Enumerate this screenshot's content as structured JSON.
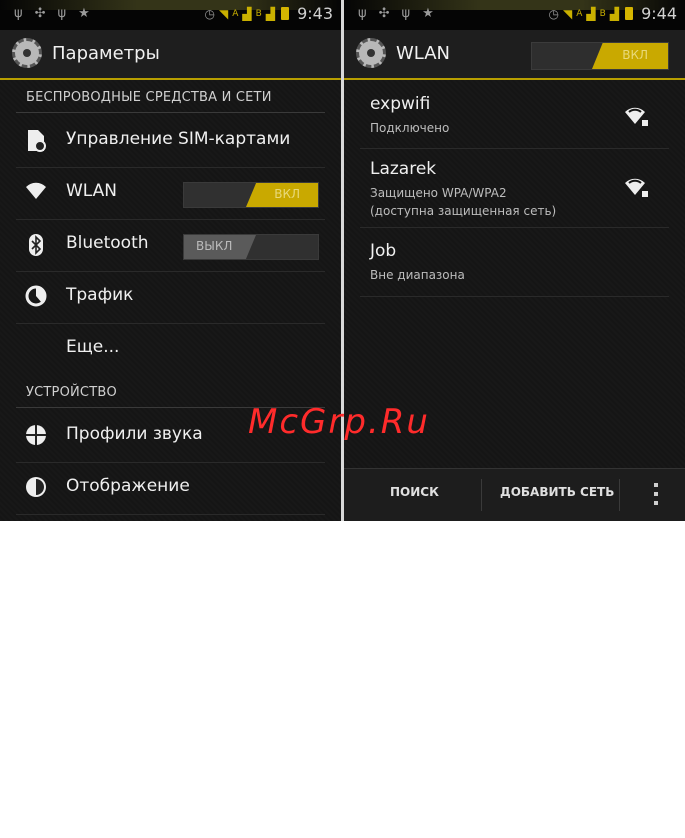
{
  "colors": {
    "accent": "#c9a900",
    "background": "#151515",
    "watermark": "#ff2b2b"
  },
  "watermark": "McGrp.Ru",
  "left": {
    "status": {
      "time": "9:43",
      "carrier1": "A",
      "carrier2": "B"
    },
    "title": "Параметры",
    "title_icon": "gear-icon",
    "sections": [
      {
        "header": "БЕСПРОВОДНЫЕ СРЕДСТВА И СЕТИ"
      },
      {
        "header": "УСТРОЙСТВО"
      }
    ],
    "items": [
      {
        "label": "Управление SIM-картами",
        "icon": "sim-card-icon"
      },
      {
        "label": "WLAN",
        "icon": "wifi-icon",
        "toggle": "ВКЛ"
      },
      {
        "label": "Bluetooth",
        "icon": "bluetooth-icon",
        "toggle": "ВЫКЛ"
      },
      {
        "label": "Трафик",
        "icon": "data-usage-icon"
      },
      {
        "label": "Еще..."
      },
      {
        "label": "Профили звука",
        "icon": "sound-profile-icon"
      },
      {
        "label": "Отображение",
        "icon": "display-icon"
      }
    ]
  },
  "right": {
    "status": {
      "time": "9:44",
      "carrier1": "A",
      "carrier2": "B"
    },
    "title": "WLAN",
    "title_toggle": "ВКЛ",
    "networks": [
      {
        "name": "expwifi",
        "status": "Подключено",
        "icon": "wifi-secure-icon"
      },
      {
        "name": "Lazarek",
        "status": "Защищено WPA/WPA2",
        "status2": "(доступна защищенная сеть)",
        "icon": "wifi-secure-icon"
      },
      {
        "name": "Job",
        "status": "Вне диапазона"
      }
    ],
    "bottom": {
      "search": "ПОИСК",
      "add": "ДОБАВИТЬ СЕТЬ",
      "menu_icon": "overflow-menu-icon"
    }
  }
}
